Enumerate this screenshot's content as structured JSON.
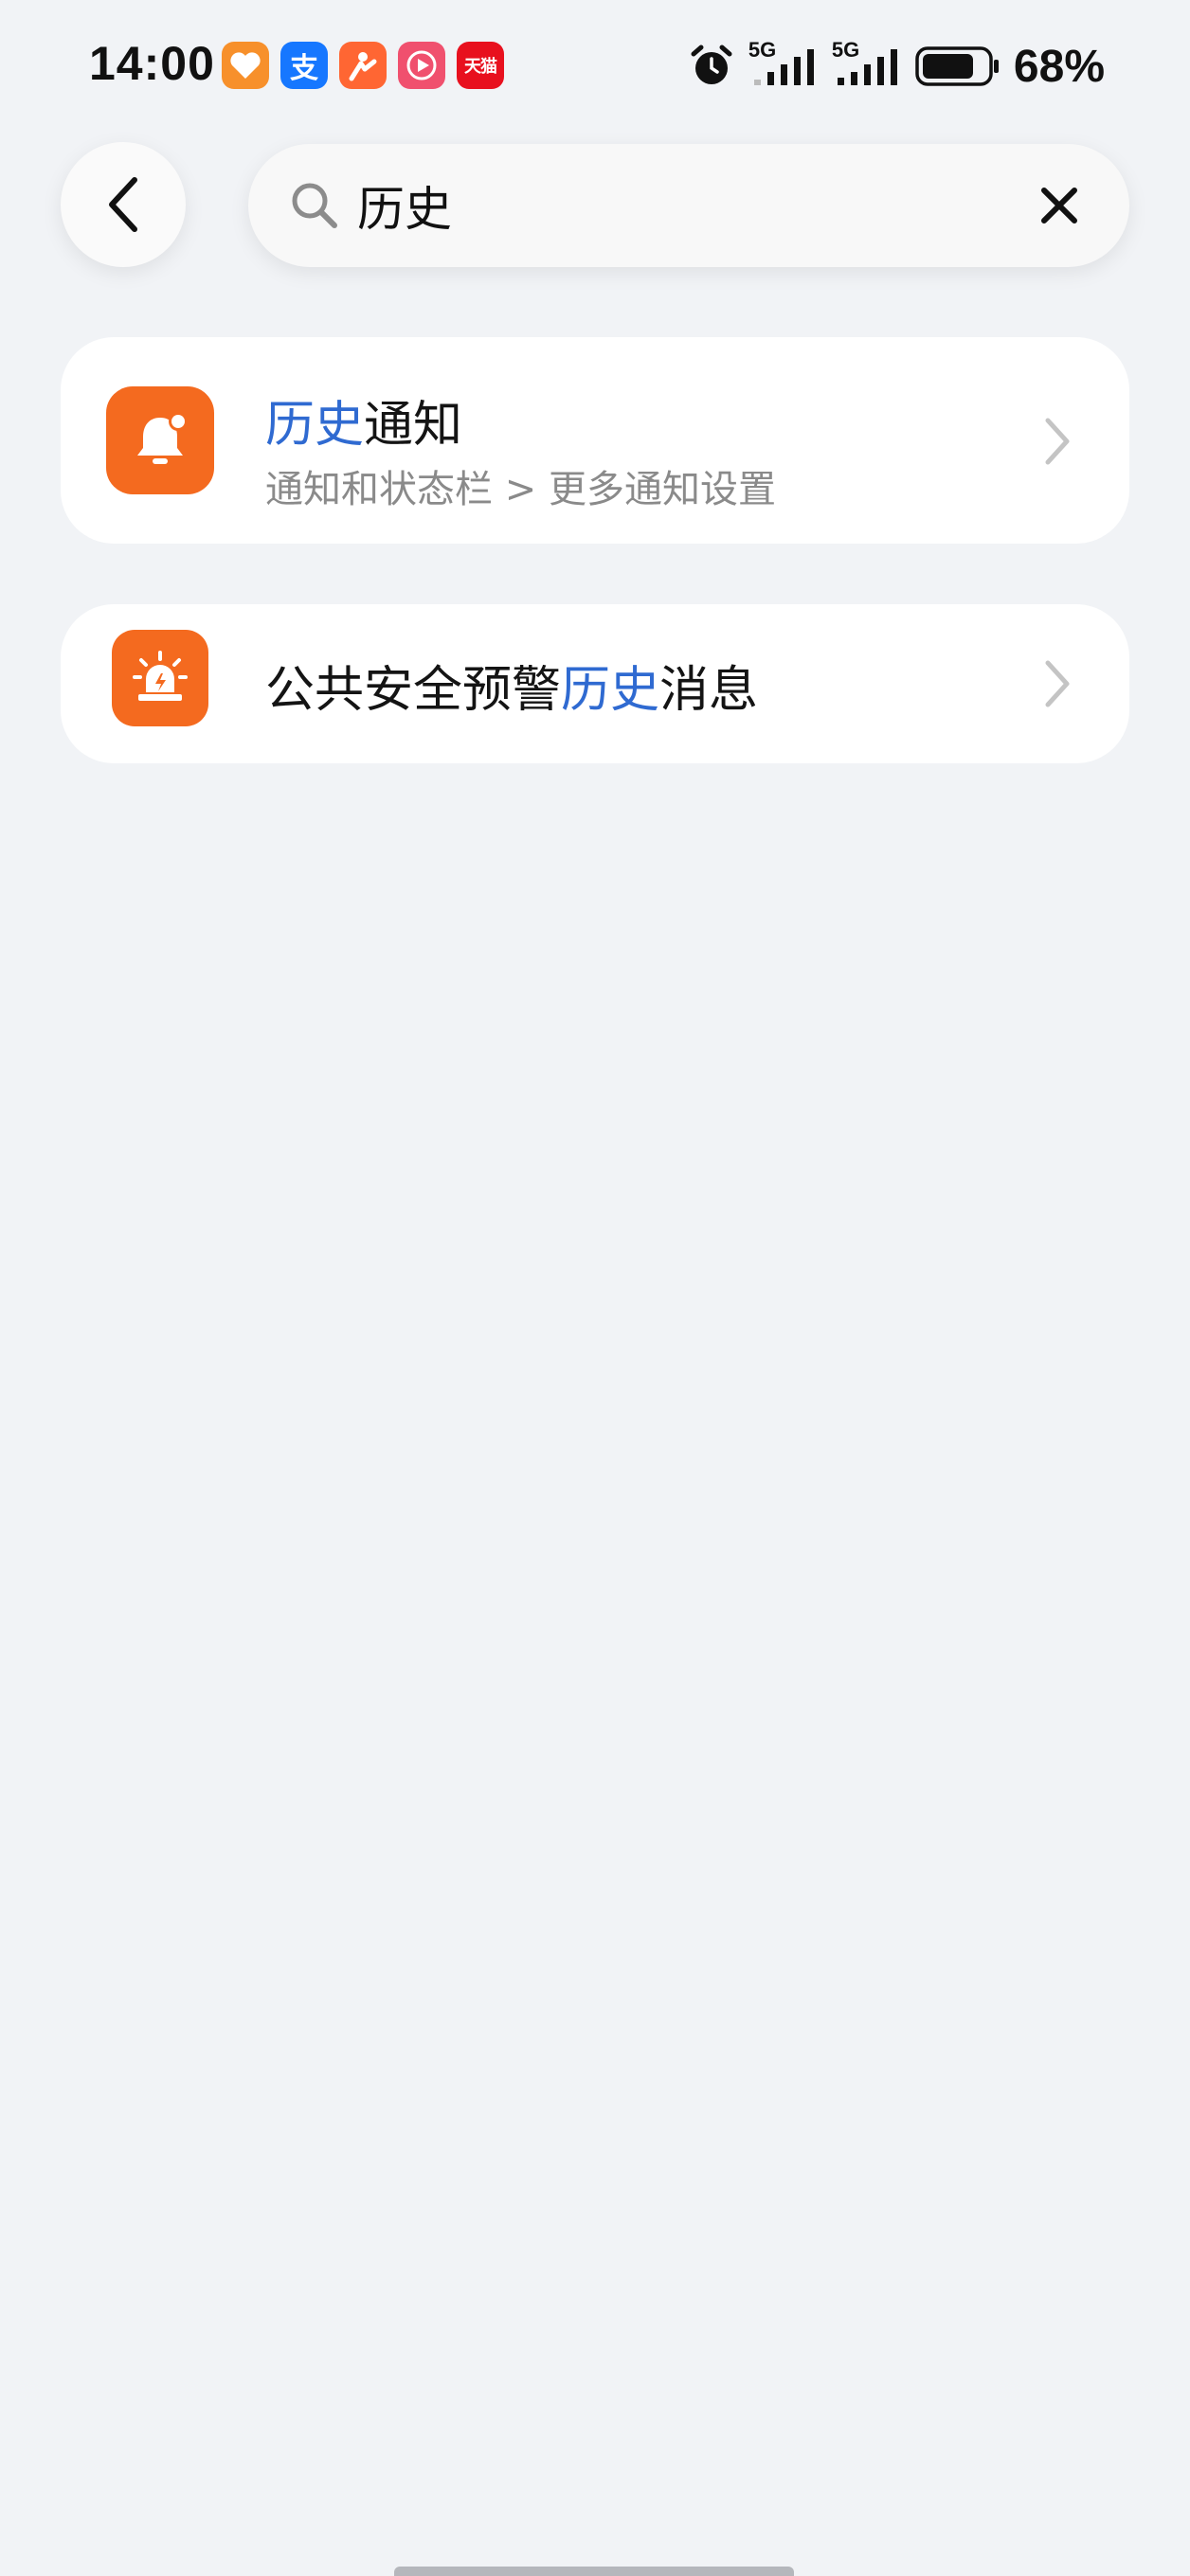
{
  "status_bar": {
    "time": "14:00",
    "apps": [
      {
        "name": "health-app-icon",
        "glyph": "♥",
        "color": "#f7902b"
      },
      {
        "name": "alipay-app-icon",
        "glyph": "支",
        "color": "#1677ff"
      },
      {
        "name": "dianping-app-icon",
        "glyph": "ꝏ",
        "color": "#ff6633"
      },
      {
        "name": "video-app-icon",
        "glyph": "▶",
        "color": "#f0506e"
      },
      {
        "name": "tmall-app-icon",
        "glyph": "天猫",
        "color": "#e8101e"
      }
    ],
    "network_1": "5G",
    "network_2": "5G",
    "battery_percent": "68%"
  },
  "search": {
    "query": "历史",
    "placeholder": ""
  },
  "results": [
    {
      "title_highlight": "历史",
      "title_rest": "通知",
      "subtitle": "通知和状态栏 > 更多通知设置",
      "icon": "notification-bell-icon"
    },
    {
      "title_prefix": "公共安全预警",
      "title_highlight": "历史",
      "title_suffix": "消息",
      "icon": "emergency-alert-icon"
    }
  ],
  "colors": {
    "accent": "#2f6ad1",
    "icon_orange": "#f46a1f",
    "background": "#f1f3f6",
    "card": "#ffffff"
  }
}
